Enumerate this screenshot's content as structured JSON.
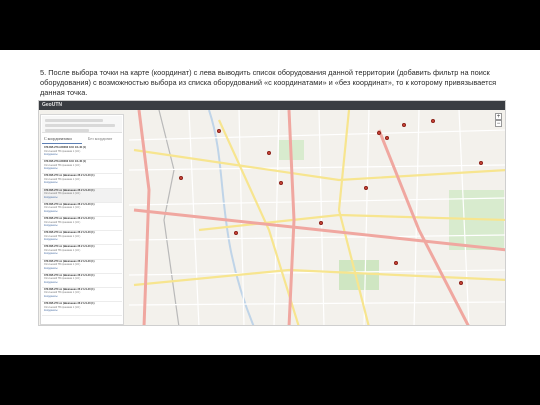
{
  "caption": "5. После выбора точки на карте (координат) с лева выводить список оборудования данной территории (добавить фильтр на поиск оборудования) с возможностью выбора из списка оборудований «с координатами» и «без координат», то к которому привязывается данная точка.",
  "app": {
    "brand": "GeoUTN"
  },
  "sidebar": {
    "tabs": [
      "С координатами",
      "Без координат"
    ],
    "items": [
      {
        "title": "370.095.270.А00002 1/10 1/4-40 (1)",
        "sub": "Оптический ТВ приемник 1 (1/4 )",
        "link": "Координаты"
      },
      {
        "title": "370.095.270.А00002 1/10 1/4-40 (1)",
        "sub": "Оптический ТВ приемник 1 (1/4 )",
        "link": "Координаты"
      },
      {
        "title": "370.095.270 лс (Шевченко 36 2 1/4-40 (1)",
        "sub": "Оптический ТВ приемник 1 (1/4 )",
        "link": "Координаты"
      },
      {
        "title": "370.095.270 лс (Шевченко 36 2 1/4-40 (1)",
        "sub": "Оптический ТВ приемник 1 (1/4 )",
        "link": "Координаты"
      },
      {
        "title": "370.095.270 лс (Шевченко 36 2 1/4-40 (1)",
        "sub": "Оптический ТВ приемник 1 (1/4 )",
        "link": "Координаты"
      },
      {
        "title": "370.095.270 лс (Шевченко 36 2 1/4-40 (1)",
        "sub": "Оптический ТВ приемник 1 (1/4 )",
        "link": "Координаты"
      },
      {
        "title": "370.095.270 лс (Шевченко 36 2 1/4-40 (1)",
        "sub": "Оптический ТВ приемник 1 (1/4 )",
        "link": "Координаты"
      },
      {
        "title": "370.095.270 лс (Шевченко 36 2 1/4-40 (1)",
        "sub": "Оптический ТВ приемник 1 (1/4 )",
        "link": "Координаты"
      },
      {
        "title": "370.095.270 лс (Шевченко 36 2 1/4-40 (1)",
        "sub": "Оптический ТВ приемник 1 (1/4 )",
        "link": "Координаты"
      },
      {
        "title": "370.095.270 лс (Шевченко 36 2 1/4-40 (1)",
        "sub": "Оптический ТВ приемник 1 (1/4 )",
        "link": "Координаты"
      },
      {
        "title": "370.095.270 лс (Шевченко 36 2 1/4-40 (1)",
        "sub": "Оптический ТВ приемник 1 (1/4 )",
        "link": "Координаты"
      },
      {
        "title": "370.095.270 лс (Шевченко 36 2 1/4-40 (1)",
        "sub": "Оптический ТВ приемник 1 (1/4 )",
        "link": "Координаты"
      }
    ]
  },
  "map": {
    "zoom_in": "+",
    "zoom_out": "−",
    "colors": {
      "land": "#f3f1ec",
      "major_road": "#f0a7a0",
      "minor_road": "#f7e58f",
      "park": "#cfe6c2",
      "pin": "#d24b3e"
    }
  }
}
